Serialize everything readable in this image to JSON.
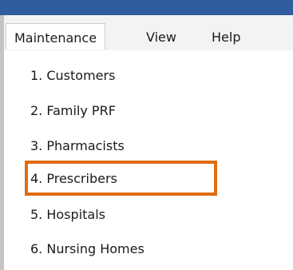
{
  "menubar": {
    "items": [
      {
        "label": "Maintenance",
        "active": true
      },
      {
        "label": "View",
        "active": false
      },
      {
        "label": "Help",
        "active": false
      }
    ]
  },
  "dropdown": {
    "items": [
      {
        "label": "1. Customers"
      },
      {
        "label": "2. Family PRF"
      },
      {
        "label": "3. Pharmacists"
      },
      {
        "label": "4. Prescribers",
        "highlighted": true
      },
      {
        "label": "5. Hospitals"
      },
      {
        "label": "6. Nursing Homes"
      }
    ]
  },
  "colors": {
    "titlebar": "#2f5d9e",
    "highlight": "#e06c12"
  }
}
